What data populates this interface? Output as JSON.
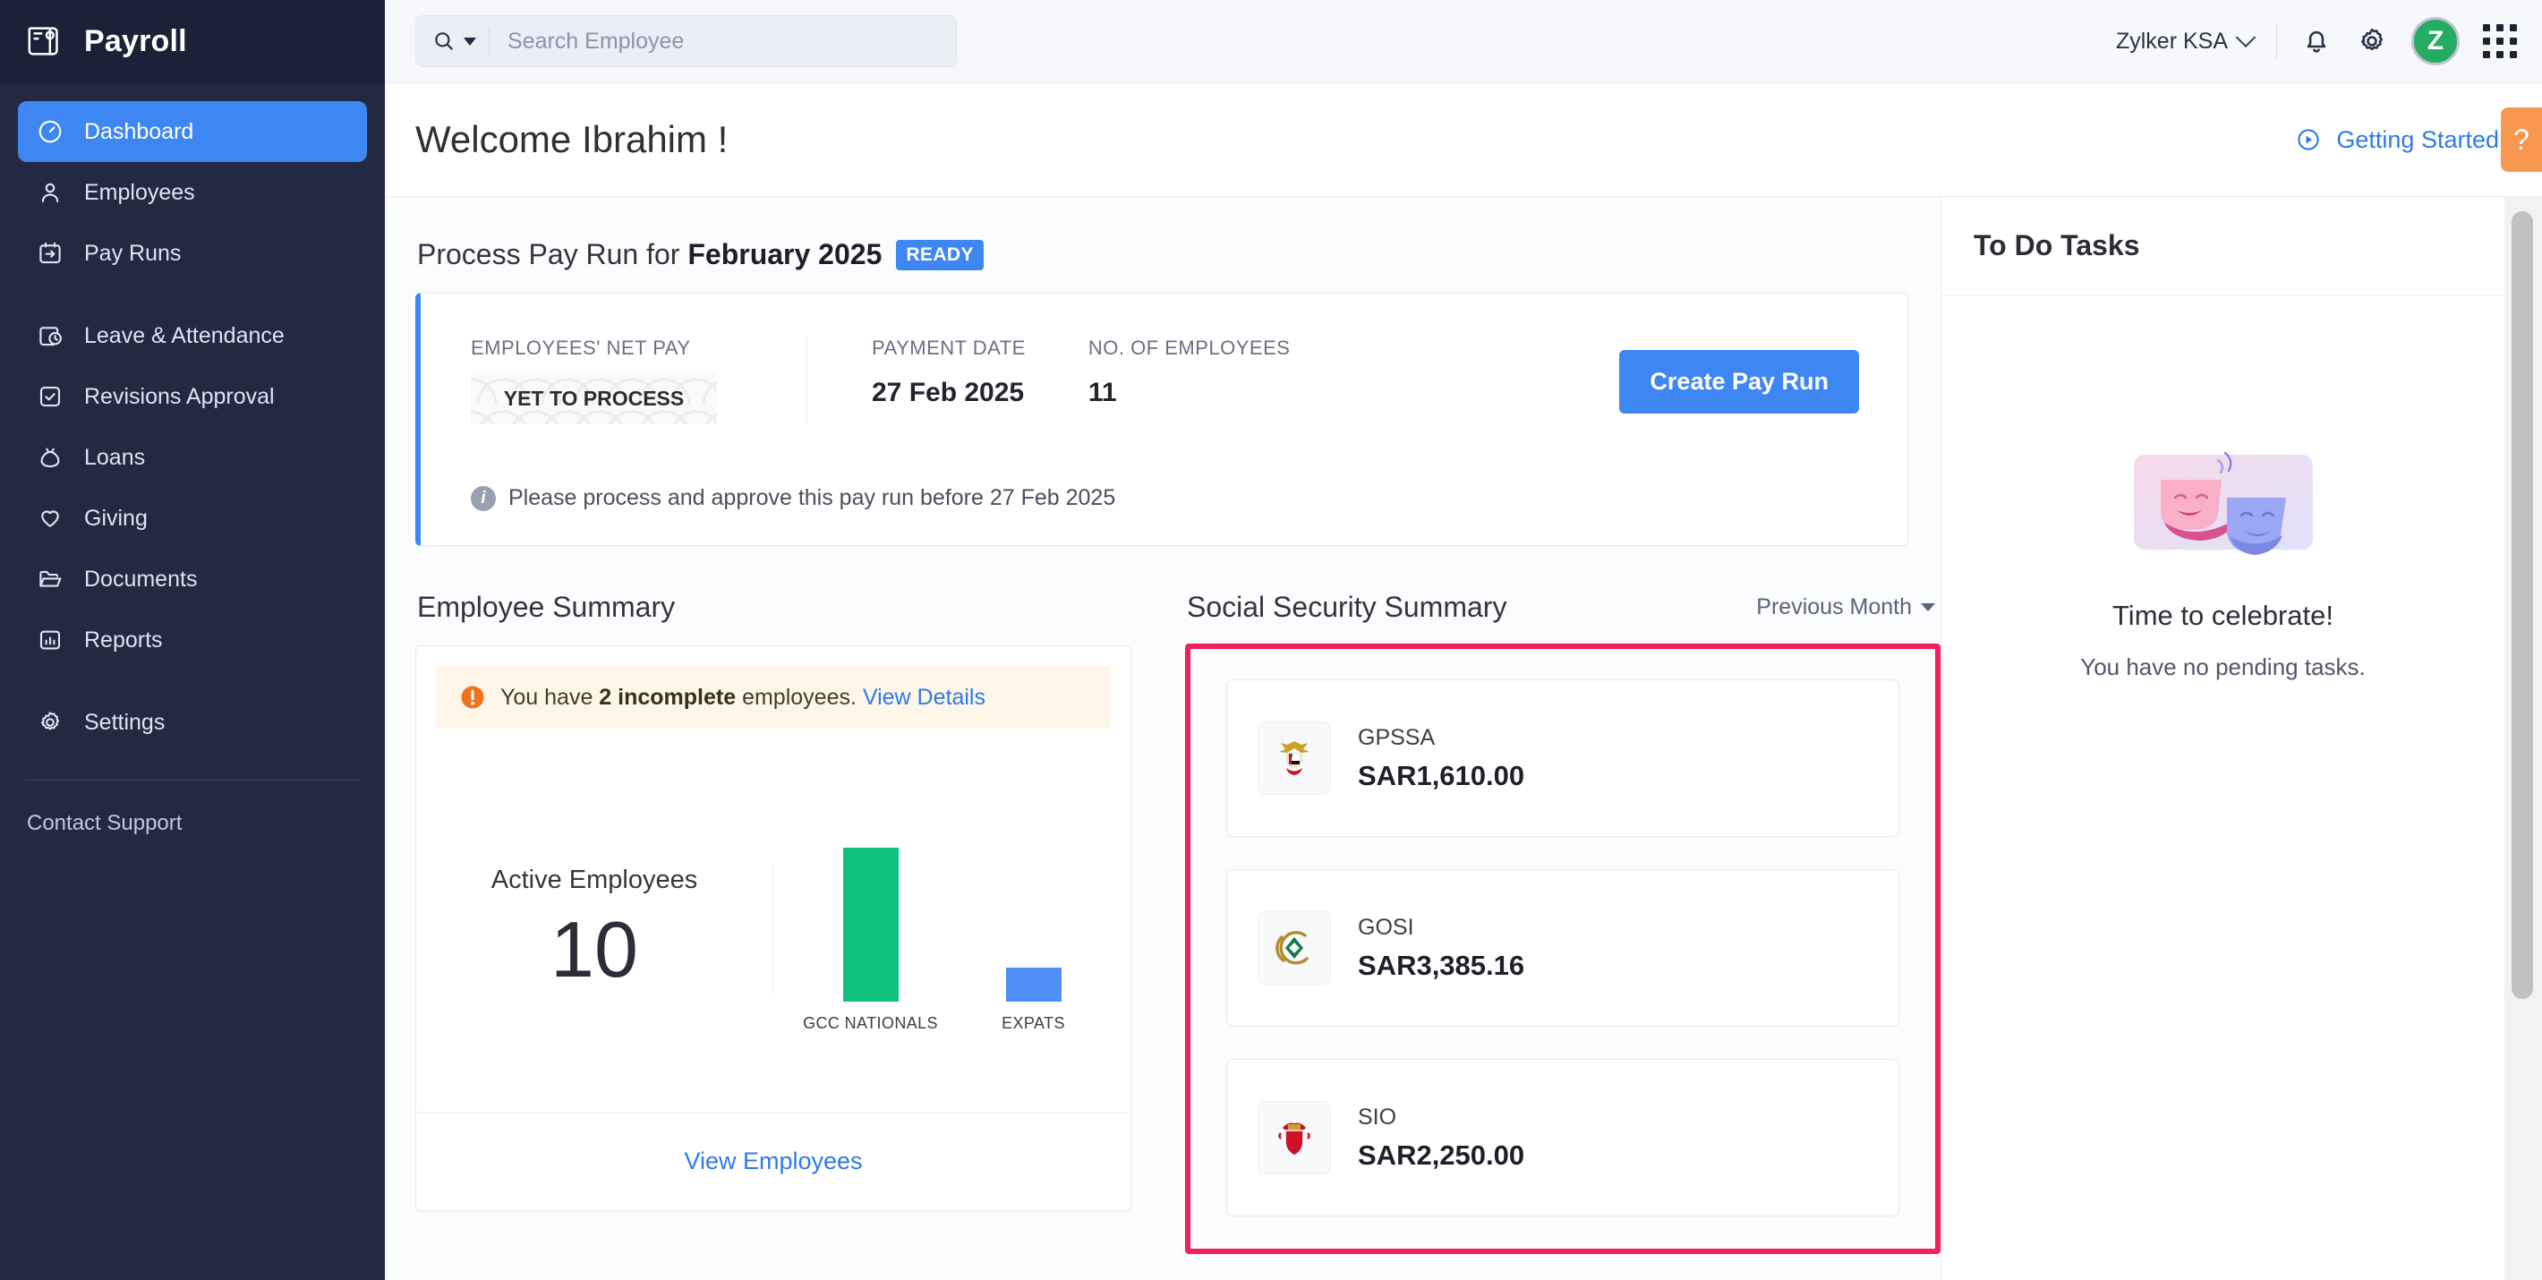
{
  "sidebar": {
    "brand": "Payroll",
    "items": [
      {
        "label": "Dashboard",
        "icon": "gauge-icon",
        "active": true
      },
      {
        "label": "Employees",
        "icon": "person-icon",
        "active": false
      },
      {
        "label": "Pay Runs",
        "icon": "calendar-arrow-icon",
        "active": false
      },
      {
        "label": "Leave & Attendance",
        "icon": "calendar-clock-icon",
        "active": false
      },
      {
        "label": "Revisions Approval",
        "icon": "check-square-icon",
        "active": false
      },
      {
        "label": "Loans",
        "icon": "money-bag-icon",
        "active": false
      },
      {
        "label": "Giving",
        "icon": "heart-icon",
        "active": false
      },
      {
        "label": "Documents",
        "icon": "folder-icon",
        "active": false
      },
      {
        "label": "Reports",
        "icon": "bar-chart-icon",
        "active": false
      },
      {
        "label": "Settings",
        "icon": "gear-icon",
        "active": false
      }
    ],
    "support": "Contact Support"
  },
  "topbar": {
    "search_placeholder": "Search Employee",
    "org_name": "Zylker KSA",
    "avatar_initial": "Z"
  },
  "welcome": {
    "title": "Welcome Ibrahim !",
    "getting_started": "Getting Started",
    "help_label": "?"
  },
  "payrun": {
    "heading_prefix": "Process Pay Run for ",
    "heading_month": "February 2025",
    "status_badge": "READY",
    "stats": [
      {
        "label": "EMPLOYEES' NET PAY",
        "value": "YET TO PROCESS"
      },
      {
        "label": "PAYMENT DATE",
        "value": "27 Feb 2025"
      },
      {
        "label": "NO. OF EMPLOYEES",
        "value": "11"
      }
    ],
    "create_button": "Create Pay Run",
    "note": "Please process and approve this pay run before 27 Feb 2025"
  },
  "employee_summary": {
    "title": "Employee Summary",
    "alert_pre": "You have ",
    "alert_bold": "2 incomplete",
    "alert_post": " employees. ",
    "alert_link": "View Details",
    "active_label": "Active Employees",
    "active_count": "10",
    "view_link": "View Employees"
  },
  "social_security": {
    "title": "Social Security Summary",
    "period_filter": "Previous Month",
    "cards": [
      {
        "name": "GPSSA",
        "amount": "SAR1,610.00",
        "icon": "uae-emblem-icon"
      },
      {
        "name": "GOSI",
        "amount": "SAR3,385.16",
        "icon": "gosi-logo-icon"
      },
      {
        "name": "SIO",
        "amount": "SAR2,250.00",
        "icon": "bahrain-emblem-icon"
      }
    ]
  },
  "todo": {
    "title": "To Do Tasks",
    "empty_heading": "Time to celebrate!",
    "empty_text": "You have no pending tasks."
  },
  "colors": {
    "sidebar_bg": "#222a41",
    "accent_blue": "#3e87f2",
    "highlight_pink": "#f4205e",
    "green_bar": "#0ec27b",
    "blue_bar": "#4f8ff7",
    "avatar_green": "#26ab63",
    "help_orange": "#f79750"
  },
  "chart_data": {
    "type": "bar",
    "title": "Employee Summary",
    "categories": [
      "GCC NATIONALS",
      "EXPATS"
    ],
    "values": [
      9,
      2
    ],
    "colors": [
      "#0ec27b",
      "#4f8ff7"
    ],
    "xlabel": "",
    "ylabel": "",
    "ylim": [
      0,
      10
    ],
    "grid": false,
    "legend": "none",
    "annotations": [
      "Active Employees: 10"
    ]
  }
}
